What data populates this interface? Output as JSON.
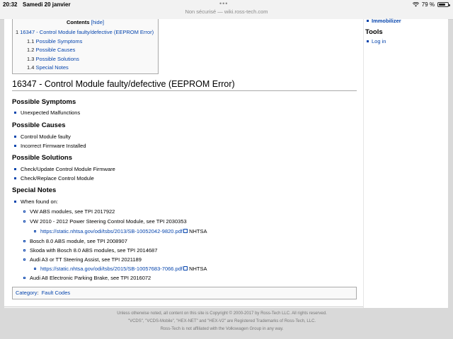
{
  "status_bar": {
    "time": "20:32",
    "date": "Samedi 20 janvier",
    "battery": "79 %",
    "battery_level": 0.79
  },
  "address_bar": {
    "url": "Non sécurisé — wiki.ross-tech.com"
  },
  "toc": {
    "title": "Contents",
    "hide_label": "[hide]",
    "items": [
      {
        "num": "1",
        "label": "16347 - Control Module faulty/defective (EEPROM Error)"
      },
      {
        "num": "1.1",
        "label": "Possible Symptoms"
      },
      {
        "num": "1.2",
        "label": "Possible Causes"
      },
      {
        "num": "1.3",
        "label": "Possible Solutions"
      },
      {
        "num": "1.4",
        "label": "Special Notes"
      }
    ]
  },
  "article": {
    "title": "16347 - Control Module faulty/defective (EEPROM Error)",
    "symptoms": {
      "heading": "Possible Symptoms",
      "items": [
        "Unexpected Malfunctions"
      ]
    },
    "causes": {
      "heading": "Possible Causes",
      "items": [
        "Control Module faulty",
        "Incorrect Firmware Installed"
      ]
    },
    "solutions": {
      "heading": "Possible Solutions",
      "items": [
        "Check/Update Control Module Firmware",
        "Check/Replace Control Module"
      ]
    },
    "notes": {
      "heading": "Special Notes",
      "when_found": "When found on:",
      "entries": [
        "VW ABS modules, see TPI 2017922",
        "VW 2010 - 2012 Power Steering Control Module, see TPI 2030353",
        "https://static.nhtsa.gov/odi/tsbs/2013/SB-10052042-9820.pdf",
        "NHTSA",
        "Bosch 8.0 ABS module, see TPI 2008907",
        "Skoda with Bosch 8.0 ABS modules, see TPI 2014687",
        "Audi A3 or TT Steering Assist, see TPI 2021189",
        "https://static.nhtsa.gov/odi/tsbs/2015/SB-10057683-7066.pdf",
        "NHTSA",
        "Audi A8 Electronic Parking Brake, see TPI 2016072"
      ]
    }
  },
  "category": {
    "label": "Category",
    "value": "Fault Codes"
  },
  "sidebar": {
    "immobilizer": "Immobilizer",
    "tools_heading": "Tools",
    "login": "Log in"
  },
  "footer": {
    "line1": "Unless otherwise noted, all content on this site is Copyright © 2000-2017 by Ross-Tech LLC. All rights reserved.",
    "line2": "\"VCDS\", \"VCDS-Mobile\", \"HEX-NET\" and \"HEX-V2\" are Registered Trademarks of Ross-Tech, LLC.",
    "line3": "Ross-Tech is not affiliated with the Volkswagen Group in any way."
  }
}
